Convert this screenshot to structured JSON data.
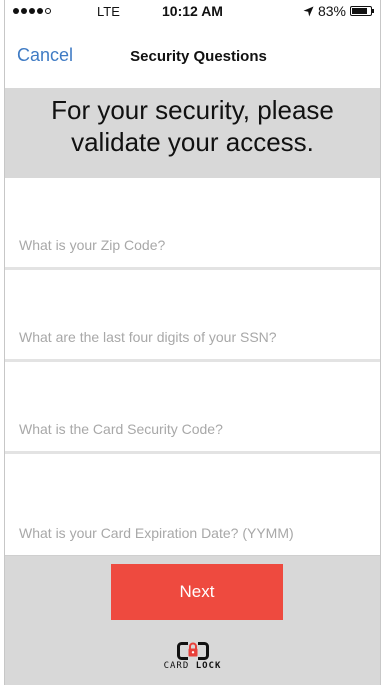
{
  "status_bar": {
    "carrier": "LTE",
    "time": "10:12 AM",
    "battery": "83%",
    "battery_level": 0.83,
    "signal_bars_filled": 4,
    "signal_bars_total": 5
  },
  "nav": {
    "cancel_label": "Cancel",
    "title": "Security Questions"
  },
  "heading": "For your security, please validate your access.",
  "fields": [
    {
      "placeholder": "What is your Zip Code?",
      "value": ""
    },
    {
      "placeholder": "What are the last four digits of your SSN?",
      "value": ""
    },
    {
      "placeholder": "What is the Card Security Code?",
      "value": ""
    },
    {
      "placeholder": "What is your Card Expiration Date? (YYMM)",
      "value": ""
    }
  ],
  "next_label": "Next",
  "logo": {
    "word1": "CARD",
    "word2": "LOCK"
  },
  "colors": {
    "accent_blue": "#3f7bc4",
    "button_red": "#ee4a3f",
    "background_gray": "#d8d8d8"
  },
  "icons": {
    "location": "location-arrow-icon",
    "battery": "battery-icon",
    "logo": "card-lock-icon"
  }
}
